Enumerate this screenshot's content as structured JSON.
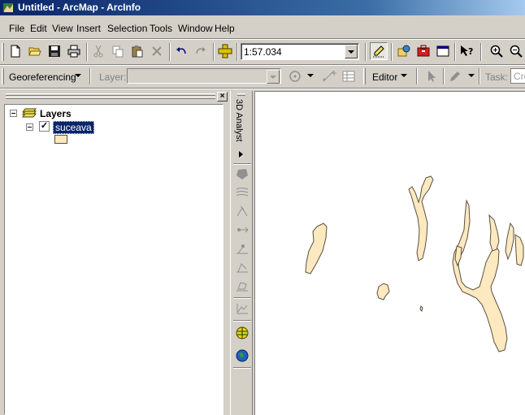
{
  "window": {
    "title": "Untitled - ArcMap - ArcInfo"
  },
  "menu": [
    {
      "label": "File"
    },
    {
      "label": "Edit"
    },
    {
      "label": "View"
    },
    {
      "label": "Insert"
    },
    {
      "label": "Selection"
    },
    {
      "label": "Tools"
    },
    {
      "label": "Window"
    },
    {
      "label": "Help"
    }
  ],
  "standard_toolbar": {
    "scale_value": "1:57.034"
  },
  "georef_toolbar": {
    "georeferencing_label": "Georeferencing",
    "layer_label": "Layer:",
    "layer_value": "",
    "editor_label": "Editor",
    "task_label": "Task:",
    "task_value": "Cre"
  },
  "toc": {
    "root_label": "Layers",
    "layers": [
      {
        "name": "suceava",
        "checked": true,
        "fill_color": "#fce9bf"
      }
    ]
  },
  "analyst_toolbar": {
    "title": "3D Analyst"
  },
  "colors": {
    "titlebar": "#0a246a",
    "selection": "#0a246a",
    "polygon_fill": "#fce9bf",
    "face": "#d4d0c8"
  }
}
